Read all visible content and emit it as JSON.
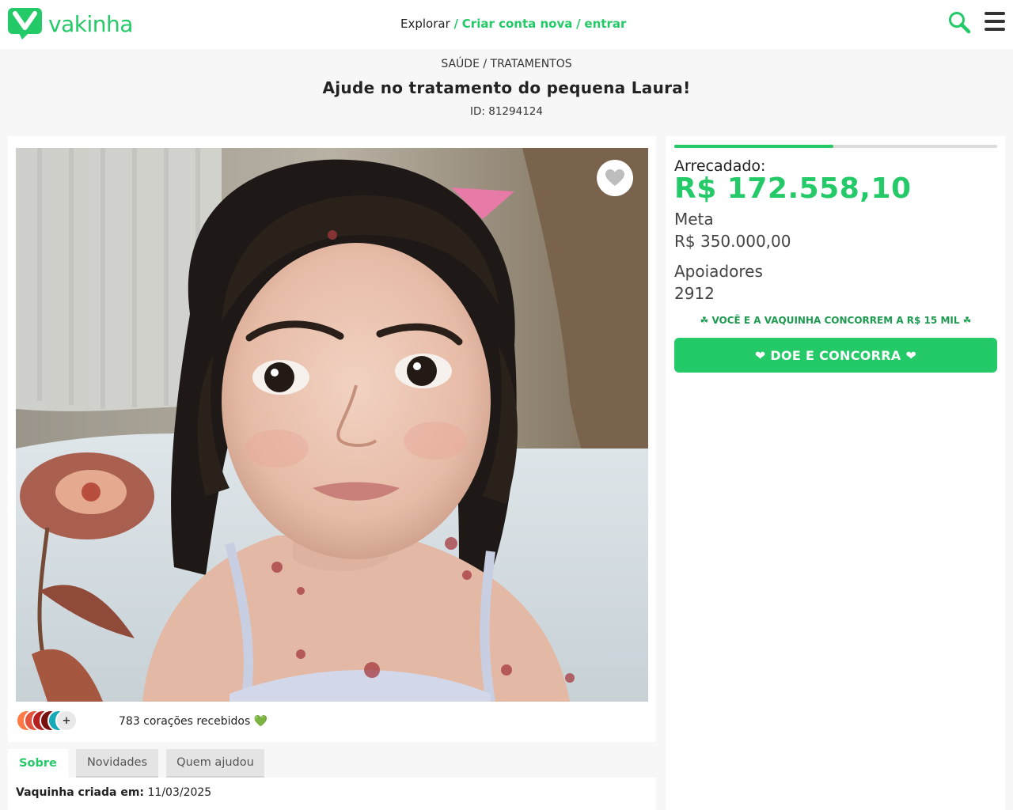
{
  "header": {
    "logo_text": "vakinha",
    "nav_explore": "Explorar",
    "nav_sep1": "/",
    "nav_create": "Criar conta nova",
    "nav_sep2": "/",
    "nav_login": "entrar",
    "search_icon": "search-icon",
    "menu_icon": "hamburger-menu-icon"
  },
  "campaign": {
    "category": "SAÚDE / TRATAMENTOS",
    "title": "Ajude no tratamento do pequena Laura!",
    "id_text": "ID: 81294124",
    "hearts_text": "783 corações recebidos 💚",
    "avatars": [
      {
        "label": "",
        "color": "#ff7a45"
      },
      {
        "label": "",
        "color": "#e5533d"
      },
      {
        "label": "5",
        "color": "#b51f1f"
      },
      {
        "label": "",
        "color": "#7a1111"
      },
      {
        "label": "",
        "color": "#16a9b8"
      },
      {
        "label": "+",
        "color": "#e9e9e9"
      }
    ]
  },
  "tabs": [
    {
      "label": "Sobre",
      "active": true
    },
    {
      "label": "Novidades",
      "active": false
    },
    {
      "label": "Quem ajudou",
      "active": false
    }
  ],
  "about": {
    "created_label": "Vaquinha criada em:",
    "created_value": "11/03/2025"
  },
  "stats": {
    "progress_fraction": 0.493,
    "raised_label": "Arrecadado:",
    "raised_value": "R$ 172.558,10",
    "goal_label": "Meta",
    "goal_value": "R$ 350.000,00",
    "supporters_label": "Apoiadores",
    "supporters_value": "2912",
    "promo": "☘ VOCÊ E A VAQUINHA CONCORREM A R$ 15 MIL ☘",
    "donate_button": "❤ DOE E CONCORRA ❤"
  },
  "colors": {
    "brand": "#24ca68"
  }
}
